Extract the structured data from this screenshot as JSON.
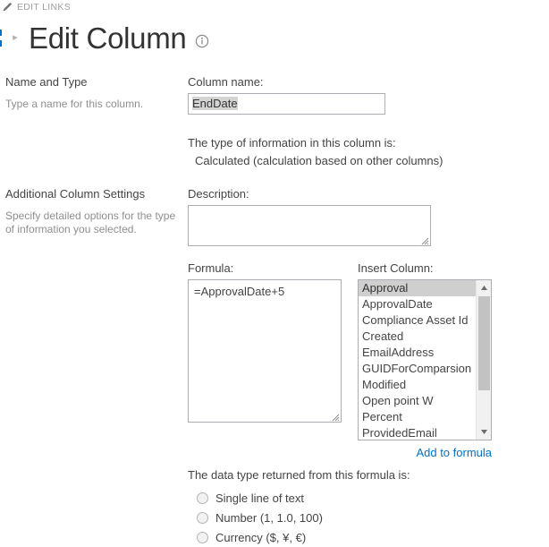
{
  "suite_bar": {
    "edit_links_label": "EDIT LINKS",
    "pencil_icon": "pencil-icon"
  },
  "header": {
    "breadcrumb_arrow": "▸",
    "title": "Edit Column",
    "info_icon": "info-icon"
  },
  "sections": {
    "name_and_type": {
      "heading": "Name and Type",
      "help": "Type a name for this column."
    },
    "additional_settings": {
      "heading": "Additional Column Settings",
      "help": "Specify detailed options for the type of information you selected."
    }
  },
  "fields": {
    "column_name": {
      "label": "Column name:",
      "value": "EndDate",
      "selected": true
    },
    "type_info": {
      "label": "The type of information in this column is:",
      "value": "Calculated (calculation based on other columns)"
    },
    "description": {
      "label": "Description:",
      "value": "",
      "placeholder": ""
    },
    "formula": {
      "label": "Formula:",
      "value": "=ApprovalDate+5"
    },
    "insert_column": {
      "label": "Insert Column:",
      "selected": "Approval",
      "options": [
        "Approval",
        "ApprovalDate",
        "Compliance Asset Id",
        "Created",
        "EmailAddress",
        "GUIDForComparsion",
        "Modified",
        "Open point W",
        "Percent",
        "ProvidedEmail"
      ]
    },
    "add_to_formula": {
      "label": "Add to formula"
    },
    "data_type": {
      "label": "The data type returned from this formula is:",
      "options": [
        {
          "label": "Single line of text",
          "checked": false
        },
        {
          "label": "Number (1, 1.0, 100)",
          "checked": false
        },
        {
          "label": "Currency ($, ¥, €)",
          "checked": false
        }
      ]
    }
  },
  "colors": {
    "link": "#0072c6",
    "accent": "#0072c6",
    "text": "#444444",
    "muted": "#8f8f8f",
    "selection": "#d4d4d4",
    "list_selection": "#cfcfcf",
    "border": "#abadb3"
  }
}
